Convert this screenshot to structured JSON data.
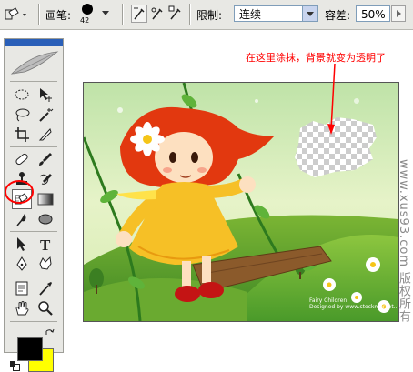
{
  "options_bar": {
    "brush_label": "画笔:",
    "brush_size": "42",
    "limit_label": "限制:",
    "limit_value": "连续",
    "tolerance_label": "容差:",
    "tolerance_value": "50%"
  },
  "annotation": "在这里涂抹，背景就变为透明了",
  "watermark": "www.xus93.com 版权所有",
  "artwork_credit": [
    "Fairy Children",
    "Designed by www.stockmarket..."
  ],
  "colors": {
    "foreground": "#000000",
    "background": "#ffff00",
    "annotation": "#ff0000"
  },
  "toolbox": {
    "selected_tool": "background-eraser-icon"
  }
}
